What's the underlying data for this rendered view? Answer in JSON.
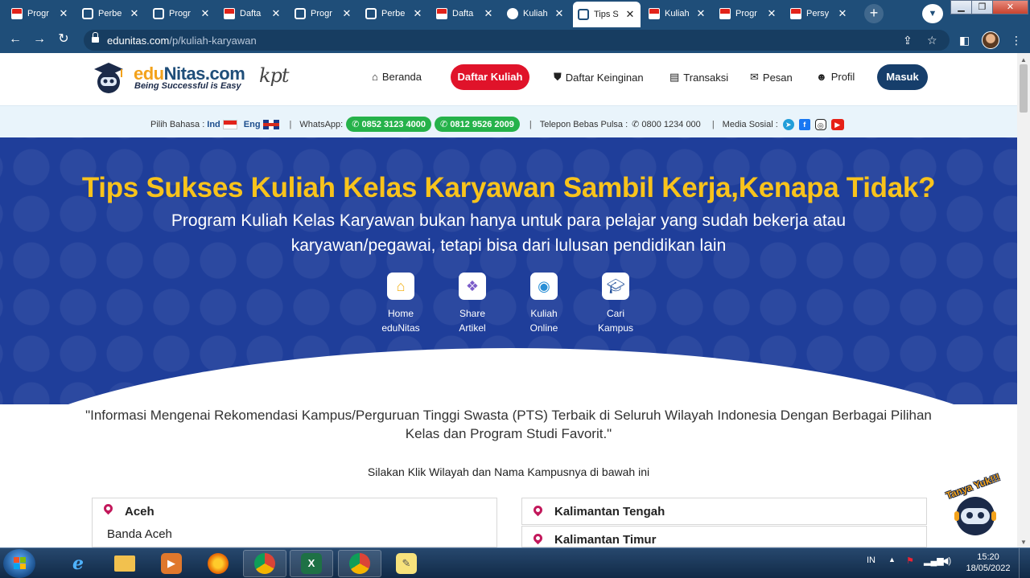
{
  "browser": {
    "tabs": [
      {
        "title": "Progr",
        "favicon": "flag"
      },
      {
        "title": "Perbe",
        "favicon": "page"
      },
      {
        "title": "Progr",
        "favicon": "page"
      },
      {
        "title": "Dafta",
        "favicon": "flag"
      },
      {
        "title": "Progr",
        "favicon": "page"
      },
      {
        "title": "Perbe",
        "favicon": "page"
      },
      {
        "title": "Dafta",
        "favicon": "flag"
      },
      {
        "title": "Kuliah",
        "favicon": "round"
      },
      {
        "title": "Tips S",
        "favicon": "page",
        "active": true
      },
      {
        "title": "Kuliah",
        "favicon": "flag"
      },
      {
        "title": "Progr",
        "favicon": "flag"
      },
      {
        "title": "Persy",
        "favicon": "flag"
      }
    ],
    "tab_close_glyph": "✕",
    "new_tab_glyph": "+",
    "url_domain": "edunitas.com",
    "url_path": "/p/kuliah-karyawan"
  },
  "site": {
    "logo_name_prefix": "edu",
    "logo_name_rest": "Nitas.com",
    "logo_tagline": "Being Successful is Easy",
    "logo_partner": "kpt",
    "nav": {
      "beranda": "Beranda",
      "daftar_kuliah": "Daftar Kuliah",
      "daftar_keinginan": "Daftar Keinginan",
      "transaksi": "Transaksi",
      "pesan": "Pesan",
      "profil": "Profil",
      "masuk": "Masuk"
    },
    "info": {
      "bahasa_label": "Pilih Bahasa :",
      "lang_ind": "Ind",
      "lang_eng": "Eng",
      "whatsapp_label": "WhatsApp:",
      "wa1": "0852 3123 4000",
      "wa2": "0812 9526 2009",
      "telepon_label": "Telepon Bebas Pulsa :",
      "telepon": "0800 1234 000",
      "sosial_label": "Media Sosial :"
    }
  },
  "hero": {
    "title": "Tips Sukses Kuliah Kelas Karyawan Sambil Kerja,Kenapa Tidak?",
    "subtitle": "Program Kuliah Kelas Karyawan bukan hanya untuk para pelajar yang sudah bekerja atau karyawan/pegawai, tetapi bisa dari lulusan pendidikan lain",
    "quick_links": [
      {
        "line1": "Home",
        "line2": "eduNitas"
      },
      {
        "line1": "Share",
        "line2": "Artikel"
      },
      {
        "line1": "Kuliah",
        "line2": "Online"
      },
      {
        "line1": "Cari",
        "line2": "Kampus"
      }
    ]
  },
  "content": {
    "intro": "\"Informasi Mengenai Rekomendasi Kampus/Perguruan Tinggi Swasta (PTS) Terbaik di Seluruh Wilayah Indonesia Dengan Berbagai Pilihan Kelas dan Program Studi Favorit.\"",
    "instruction": "Silakan Klik Wilayah dan Nama Kampusnya di bawah ini",
    "regions_left": [
      {
        "name": "Aceh",
        "city": "Banda Aceh"
      }
    ],
    "regions_right": [
      {
        "name": "Kalimantan Tengah"
      },
      {
        "name": "Kalimantan Timur"
      }
    ],
    "chat_label": "Tanya Yuk!!!"
  },
  "taskbar": {
    "lang": "IN",
    "time": "15:20",
    "date": "18/05/2022"
  },
  "colors": {
    "chrome": "#1f4e79",
    "hero_bg": "#1f3e9a",
    "hero_title": "#f8c31c",
    "daftar_btn": "#e0132a",
    "masuk_btn": "#163e6b",
    "whatsapp": "#25b24a"
  }
}
